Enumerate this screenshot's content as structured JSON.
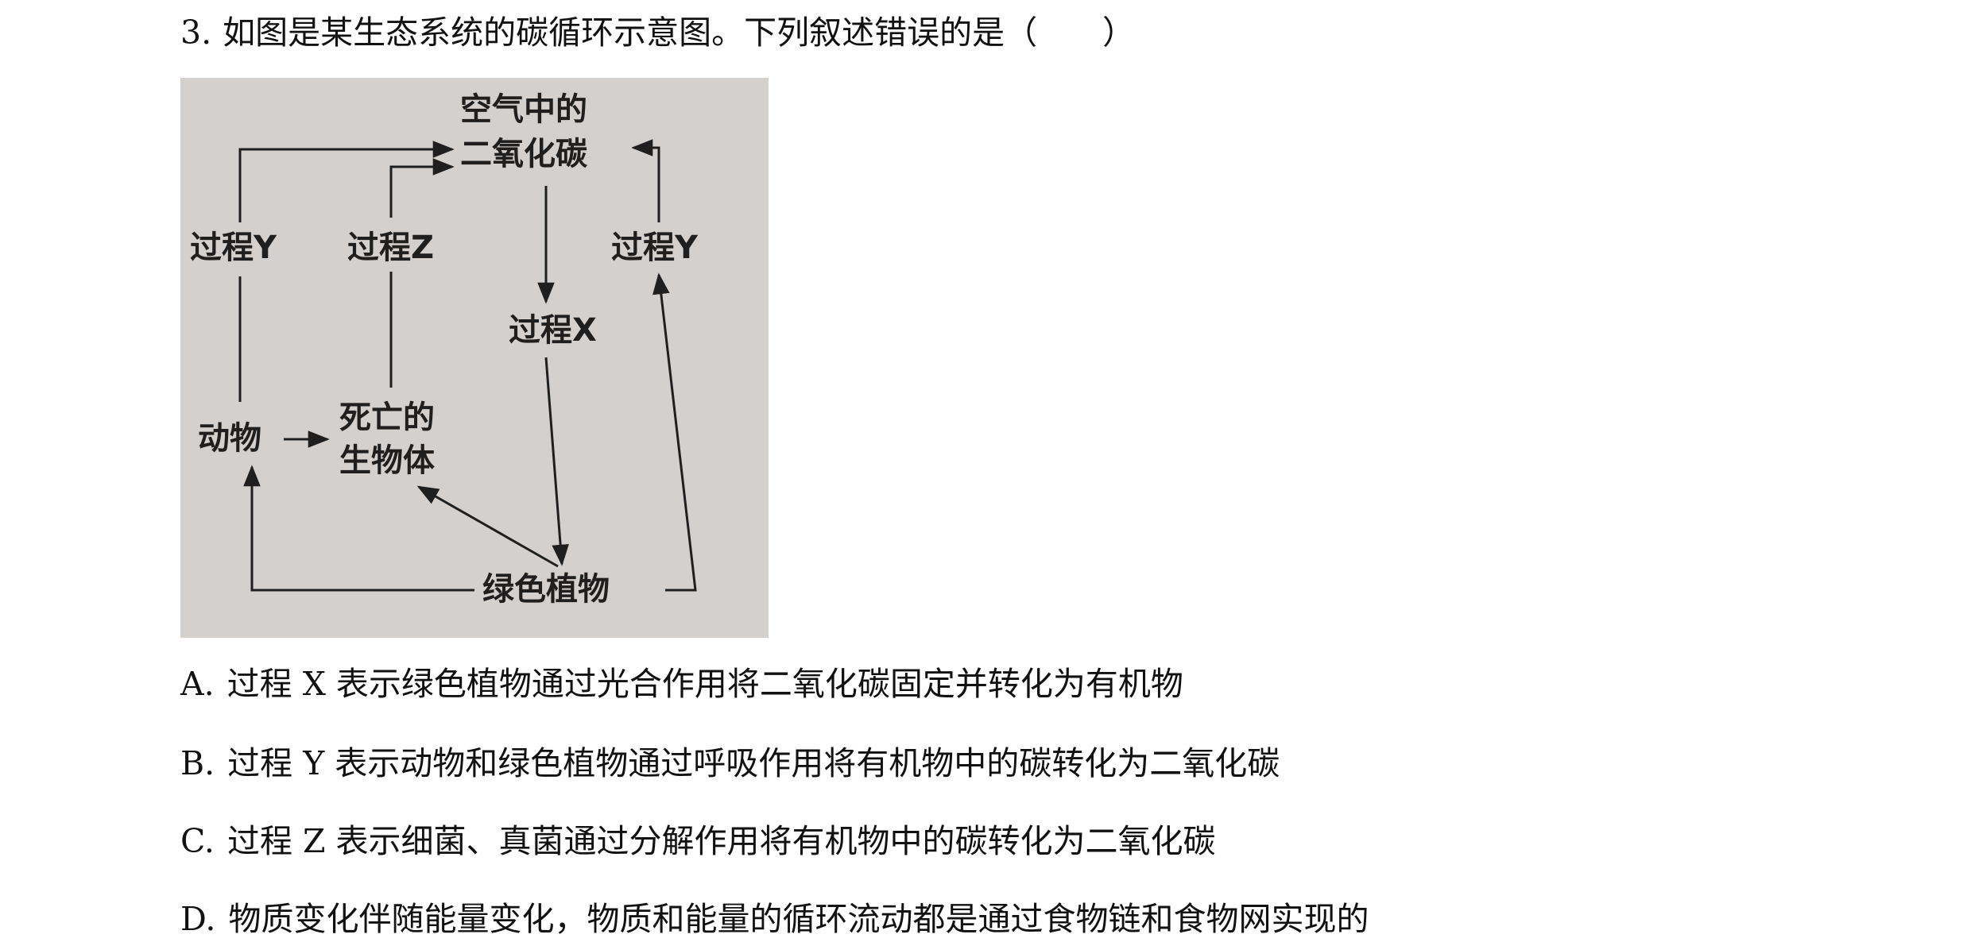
{
  "question": {
    "number": "3.",
    "text": "如图是某生态系统的碳循环示意图。下列叙述错误的是（　　）"
  },
  "diagram": {
    "co2_line1": "空气中的",
    "co2_line2": "二氧化碳",
    "process_y_left": "过程Y",
    "process_z": "过程Z",
    "process_x": "过程X",
    "process_y_right": "过程Y",
    "animal": "动物",
    "dead_line1": "死亡的",
    "dead_line2": "生物体",
    "plants": "绿色植物",
    "colors": {
      "background": "#d4d0ce",
      "ink": "#1f1f1f"
    }
  },
  "options": [
    {
      "letter": "A.",
      "text": "过程 X 表示绿色植物通过光合作用将二氧化碳固定并转化为有机物"
    },
    {
      "letter": "B.",
      "text": "过程 Y 表示动物和绿色植物通过呼吸作用将有机物中的碳转化为二氧化碳"
    },
    {
      "letter": "C.",
      "text": "过程 Z 表示细菌、真菌通过分解作用将有机物中的碳转化为二氧化碳"
    },
    {
      "letter": "D.",
      "text": "物质变化伴随能量变化，物质和能量的循环流动都是通过食物链和食物网实现的"
    }
  ]
}
